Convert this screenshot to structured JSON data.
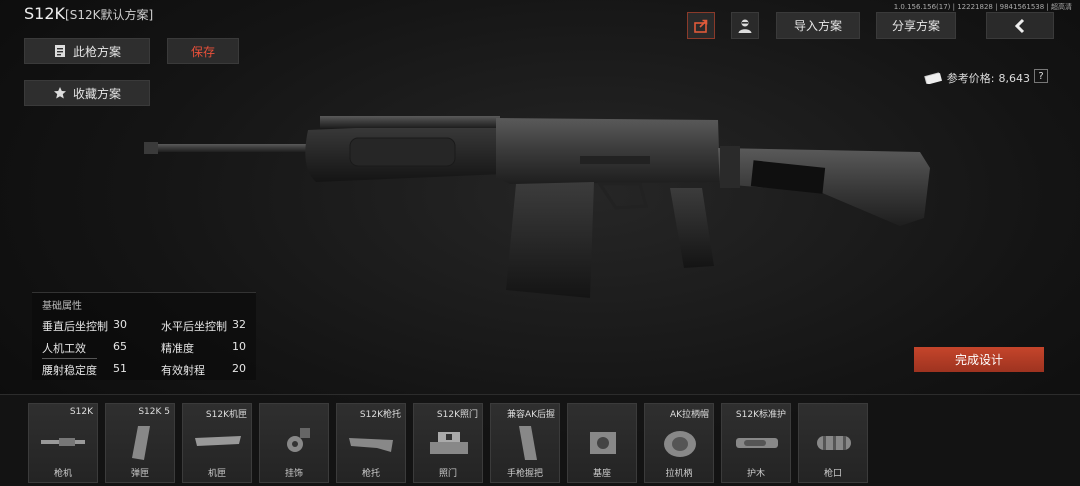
{
  "header": {
    "weapon_name": "S12K",
    "preset_name": "[S12K默认方案]",
    "version": "1.0.156.156(17) | 12221828 | 9841561538 | 超高清"
  },
  "left_buttons": {
    "gun_preset": "此枪方案",
    "save": "保存",
    "favorite": "收藏方案"
  },
  "top_buttons": {
    "import": "导入方案",
    "share": "分享方案"
  },
  "price": {
    "label": "参考价格:",
    "value": "8,643",
    "help": "?"
  },
  "stats": {
    "title": "基础属性",
    "items": [
      {
        "label": "垂直后坐控制",
        "value": "30"
      },
      {
        "label": "水平后坐控制",
        "value": "32"
      },
      {
        "label": "人机工效",
        "value": "65"
      },
      {
        "label": "精准度",
        "value": "10"
      },
      {
        "label": "腰射稳定度",
        "value": "51"
      },
      {
        "label": "有效射程",
        "value": "20"
      }
    ]
  },
  "finish_button": "完成设计",
  "parts": [
    {
      "name": "S12K",
      "type": "枪机",
      "icon": "receiver-icon"
    },
    {
      "name": "S12K 5",
      "type": "弹匣",
      "icon": "magazine-icon"
    },
    {
      "name": "S12K机匣",
      "type": "机匣",
      "icon": "dustcover-icon"
    },
    {
      "name": "",
      "type": "挂饰",
      "icon": "charm-icon"
    },
    {
      "name": "S12K枪托",
      "type": "枪托",
      "icon": "stock-icon"
    },
    {
      "name": "S12K照门",
      "type": "照门",
      "icon": "rearsight-icon"
    },
    {
      "name": "兼容AK后握",
      "type": "手枪握把",
      "icon": "grip-icon"
    },
    {
      "name": "",
      "type": "基座",
      "icon": "mount-icon"
    },
    {
      "name": "AK拉柄帽",
      "type": "拉机柄",
      "icon": "charging-handle-icon"
    },
    {
      "name": "S12K标准护",
      "type": "护木",
      "icon": "handguard-icon"
    },
    {
      "name": "",
      "type": "枪口",
      "icon": "muzzle-icon"
    }
  ]
}
